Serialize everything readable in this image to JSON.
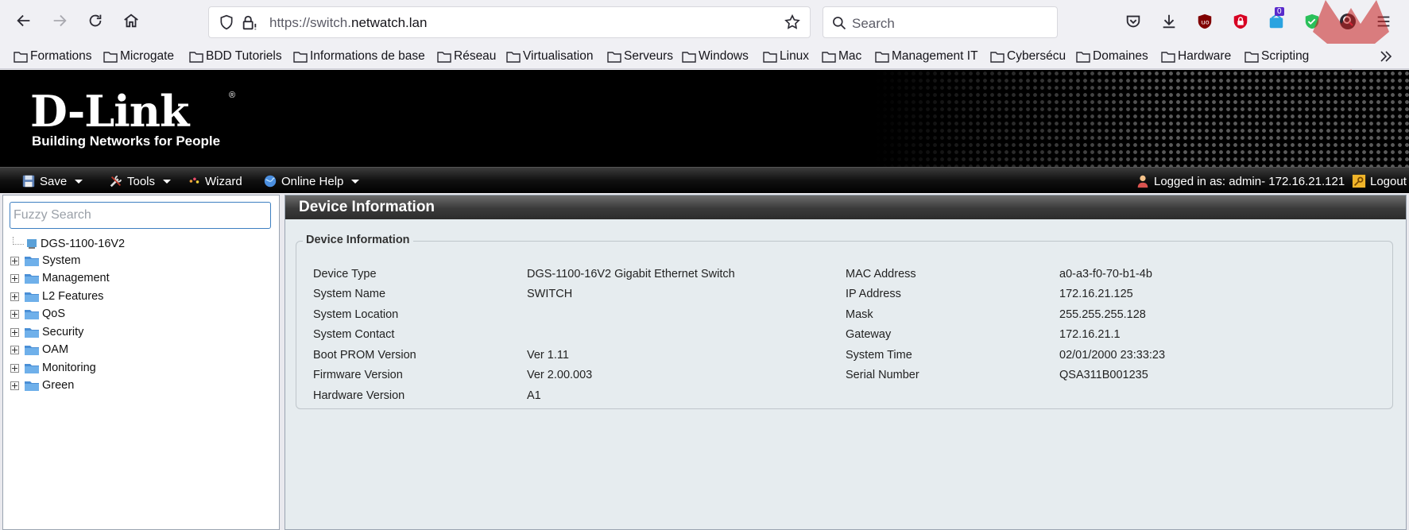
{
  "browser": {
    "url_prefix": "https://switch.",
    "url_host": "netwatch.lan",
    "search_placeholder": "Search",
    "ext_badge_count": "0",
    "bookmarks": [
      "Formations",
      "Microgate",
      "BDD Tutoriels",
      "Informations de base",
      "Réseau",
      "Virtualisation",
      "Serveurs",
      "Windows",
      "Linux",
      "Mac",
      "Management IT",
      "Cybersécu",
      "Domaines",
      "Hardware",
      "Scripting"
    ]
  },
  "header": {
    "logo_text": "D-Link",
    "logo_reg": "®",
    "tagline": "Building Networks for People"
  },
  "toolbar": {
    "save": "Save",
    "tools": "Tools",
    "wizard": "Wizard",
    "online_help": "Online Help",
    "logged_in": "Logged in as: admin- 172.16.21.121",
    "logout": "Logout"
  },
  "sidebar": {
    "search_placeholder": "Fuzzy Search",
    "root": "DGS-1100-16V2",
    "items": [
      "System",
      "Management",
      "L2 Features",
      "QoS",
      "Security",
      "OAM",
      "Monitoring",
      "Green"
    ]
  },
  "main": {
    "title": "Device Information",
    "section_title": "Device Information",
    "left_fields": [
      {
        "label": "Device Type",
        "value": "DGS-1100-16V2 Gigabit Ethernet Switch"
      },
      {
        "label": "System Name",
        "value": "SWITCH"
      },
      {
        "label": "System Location",
        "value": ""
      },
      {
        "label": "System Contact",
        "value": ""
      },
      {
        "label": "Boot PROM Version",
        "value": "Ver 1.11"
      },
      {
        "label": "Firmware Version",
        "value": "Ver 2.00.003"
      },
      {
        "label": "Hardware Version",
        "value": "A1"
      }
    ],
    "right_fields": [
      {
        "label": "MAC Address",
        "value": "a0-a3-f0-70-b1-4b"
      },
      {
        "label": "IP Address",
        "value": "172.16.21.125"
      },
      {
        "label": "Mask",
        "value": "255.255.255.128"
      },
      {
        "label": "Gateway",
        "value": "172.16.21.1"
      },
      {
        "label": "System Time",
        "value": "02/01/2000 23:33:23"
      },
      {
        "label": "Serial Number",
        "value": "QSA311B001235"
      }
    ]
  },
  "colors": {
    "header_bg": "#000000",
    "panel_bg": "#e6ecef",
    "title_bar": "#3a3a3a",
    "search_border": "#3d7fc1"
  }
}
